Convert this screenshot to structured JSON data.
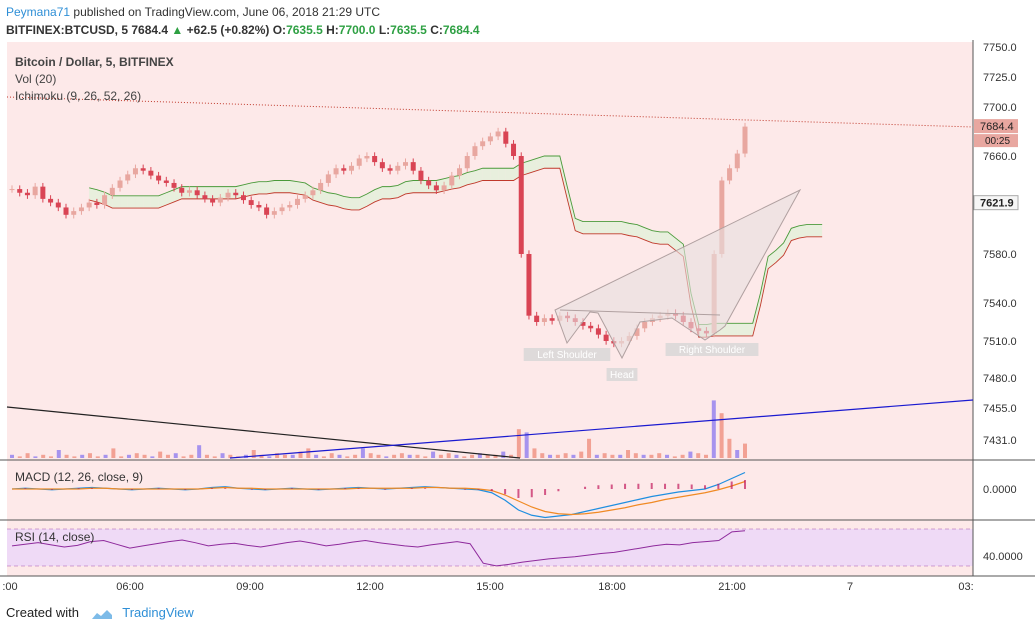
{
  "header": {
    "author": "Peymana71",
    "published_text": "published on TradingView.com, June 06, 2018 21:29 UTC",
    "symbol": "BITFINEX:BTCUSD, 5",
    "last": "7684.4",
    "change": "+62.5 (+0.82%)",
    "o_label": "O:",
    "o_value": "7635.5",
    "h_label": "H:",
    "h_value": "7700.0",
    "l_label": "L:",
    "l_value": "7635.5",
    "c_label": "C:",
    "c_value": "7684.4",
    "up_arrow": "▲"
  },
  "legend": {
    "title": "Bitcoin / Dollar, 5, BITFINEX",
    "vol": "Vol (20)",
    "ichimoku": "Ichimoku (9, 26, 52, 26)"
  },
  "macd_legend": "MACD (12, 26, close, 9)",
  "rsi_legend": "RSI (14, close)",
  "footer": {
    "created_with": "Created with",
    "brand": "TradingView"
  },
  "colors": {
    "bg_main": "#fde9e9",
    "bull": "#e8a7a0",
    "bear": "#d94454",
    "cloud_bull": "#e6efdc",
    "cloud_bear": "#f9cccc",
    "rsi_band": "#efdaf6",
    "rsi_line": "#8e2a9c",
    "macd_line": "#1f8fe0",
    "signal_line": "#f08a24",
    "volume_up": "#f2a194",
    "volume_down": "#a693ee",
    "trendline_blue": "#1a1ad0"
  },
  "chart_data": [
    {
      "type": "candlestick",
      "title": "Bitcoin / Dollar, 5, BITFINEX",
      "y_ticks": [
        "7750.0",
        "7725.0",
        "7700.0",
        "7660.0",
        "7580.0",
        "7540.0",
        "7510.0",
        "7480.0",
        "7455.0",
        "7431.0"
      ],
      "x_ticks": [
        ":00",
        "06:00",
        "09:00",
        "12:00",
        "15:00",
        "18:00",
        "21:00",
        "7",
        "03:"
      ],
      "price_labels": [
        {
          "value": "7684.4",
          "style": "last"
        },
        {
          "value": "00:25",
          "style": "countdown"
        },
        {
          "value": "7621.9",
          "style": "level"
        }
      ],
      "pattern_labels": [
        "Left Shoulder",
        "Head",
        "Right Shoulder"
      ],
      "series": [
        {
          "name": "close",
          "values": [
            7633,
            7630,
            7628,
            7635,
            7625,
            7622,
            7618,
            7612,
            7615,
            7618,
            7622,
            7620,
            7628,
            7634,
            7640,
            7645,
            7650,
            7648,
            7644,
            7640,
            7638,
            7634,
            7630,
            7632,
            7628,
            7625,
            7622,
            7626,
            7630,
            7628,
            7624,
            7620,
            7618,
            7612,
            7615,
            7618,
            7620,
            7625,
            7628,
            7632,
            7638,
            7645,
            7650,
            7648,
            7652,
            7658,
            7660,
            7655,
            7650,
            7648,
            7652,
            7655,
            7648,
            7640,
            7636,
            7632,
            7636,
            7644,
            7650,
            7660,
            7668,
            7672,
            7676,
            7680,
            7670,
            7660,
            7580,
            7530,
            7525,
            7528,
            7526,
            7530,
            7528,
            7525,
            7522,
            7520,
            7515,
            7510,
            7508,
            7510,
            7514,
            7520,
            7525,
            7528,
            7530,
            7532,
            7530,
            7525,
            7520,
            7518,
            7516,
            7580,
            7640,
            7650,
            7662,
            7684
          ]
        }
      ]
    },
    {
      "type": "bar",
      "title": "Vol (20)",
      "values": [
        2,
        1,
        3,
        1,
        2,
        1,
        5,
        2,
        1,
        2,
        3,
        1,
        2,
        6,
        1,
        2,
        3,
        2,
        1,
        4,
        2,
        3,
        1,
        2,
        8,
        2,
        1,
        3,
        2,
        1,
        2,
        5,
        2,
        1,
        3,
        2,
        2,
        4,
        6,
        2,
        1,
        3,
        2,
        1,
        2,
        6,
        3,
        2,
        1,
        2,
        3,
        2,
        2,
        1,
        4,
        2,
        3,
        2,
        1,
        2,
        3,
        2,
        2,
        4,
        2,
        18,
        16,
        6,
        3,
        2,
        2,
        3,
        2,
        4,
        12,
        2,
        3,
        2,
        2,
        5,
        3,
        2,
        2,
        3,
        2,
        1,
        2,
        4,
        3,
        2,
        36,
        28,
        12,
        5,
        9
      ]
    },
    {
      "type": "line",
      "title": "MACD (12, 26, close, 9)",
      "y_ticks": [
        "0.0000"
      ],
      "series": [
        {
          "name": "MACD",
          "values": [
            0,
            1,
            0,
            -1,
            0,
            1,
            2,
            1,
            0,
            -1,
            0,
            1,
            0,
            -1,
            0,
            2,
            3,
            1,
            0,
            -1,
            0,
            1,
            0,
            -1,
            0,
            1,
            2,
            1,
            0,
            1,
            2,
            3,
            2,
            1,
            0,
            -1,
            -5,
            -15,
            -28,
            -35,
            -38,
            -36,
            -34,
            -30,
            -26,
            -22,
            -18,
            -14,
            -10,
            -7,
            -4,
            -2,
            0,
            6,
            14,
            22
          ]
        },
        {
          "name": "Signal",
          "values": [
            0,
            0,
            0,
            0,
            0,
            0,
            1,
            1,
            0,
            0,
            0,
            0,
            0,
            0,
            0,
            1,
            2,
            1,
            1,
            0,
            0,
            0,
            0,
            0,
            0,
            0,
            1,
            1,
            1,
            1,
            1,
            2,
            2,
            1,
            1,
            0,
            -2,
            -8,
            -16,
            -24,
            -30,
            -33,
            -34,
            -33,
            -31,
            -28,
            -25,
            -21,
            -18,
            -14,
            -11,
            -8,
            -5,
            -1,
            4,
            10
          ]
        }
      ]
    },
    {
      "type": "line",
      "title": "RSI (14, close)",
      "y_ticks": [
        "40.0000"
      ],
      "series": [
        {
          "name": "RSI",
          "values": [
            52,
            55,
            58,
            54,
            50,
            53,
            60,
            62,
            55,
            48,
            52,
            56,
            60,
            63,
            58,
            52,
            55,
            57,
            53,
            50,
            54,
            58,
            61,
            57,
            52,
            55,
            59,
            62,
            58,
            55,
            52,
            50,
            54,
            57,
            60,
            56,
            20,
            15,
            18,
            22,
            25,
            28,
            30,
            32,
            35,
            38,
            40,
            44,
            48,
            52,
            55,
            54,
            58,
            60,
            62,
            78,
            80
          ]
        }
      ]
    }
  ]
}
